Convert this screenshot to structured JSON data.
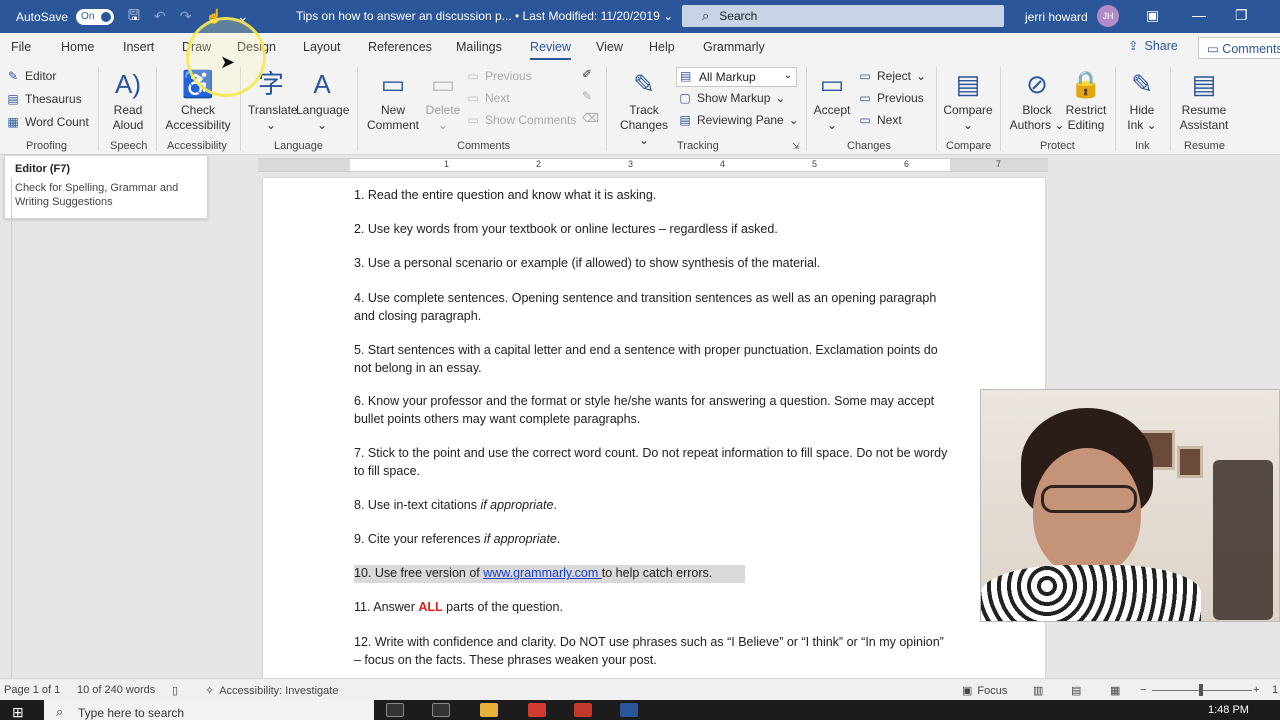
{
  "titlebar": {
    "autosave_label": "AutoSave",
    "autosave_state": "On",
    "doc_title": "Tips on how to answer an discussion p...  •  Last Modified: 11/20/2019  ⌄",
    "search_placeholder": "Search",
    "user_name": "jerri howard",
    "user_initials": "JH"
  },
  "tabs": [
    "File",
    "Home",
    "Insert",
    "Draw",
    "Design",
    "Layout",
    "References",
    "Mailings",
    "Review",
    "View",
    "Help",
    "Grammarly"
  ],
  "active_tab": "Review",
  "share_label": "Share",
  "comments_label": "Comments",
  "ribbon": {
    "proofing": {
      "editor": "Editor",
      "thesaurus": "Thesaurus",
      "word_count": "Word Count",
      "label": "Proofing"
    },
    "speech": {
      "read_aloud": "Read Aloud",
      "label": "Speech"
    },
    "accessibility": {
      "check": "Check Accessibility",
      "label": "Accessibility"
    },
    "language": {
      "translate": "Translate",
      "language": "Language",
      "label": "Language"
    },
    "comments": {
      "new_comment": "New Comment",
      "delete": "Delete",
      "previous": "Previous",
      "next": "Next",
      "show_comments": "Show Comments",
      "label": "Comments"
    },
    "tracking": {
      "track_changes": "Track Changes",
      "all_markup": "All Markup",
      "show_markup": "Show Markup",
      "reviewing_pane": "Reviewing Pane",
      "label": "Tracking"
    },
    "changes": {
      "accept": "Accept",
      "reject": "Reject",
      "previous": "Previous",
      "next": "Next",
      "label": "Changes"
    },
    "compare": {
      "compare": "Compare",
      "label": "Compare"
    },
    "protect": {
      "block_authors": "Block Authors",
      "restrict_editing": "Restrict Editing",
      "label": "Protect"
    },
    "ink": {
      "hide_ink": "Hide Ink",
      "label": "Ink"
    },
    "resume": {
      "resume_assistant": "Resume Assistant",
      "label": "Resume"
    }
  },
  "tooltip": {
    "title": "Editor (F7)",
    "body": "Check for Spelling, Grammar and Writing Suggestions"
  },
  "ruler": [
    "1",
    "2",
    "3",
    "4",
    "5",
    "6",
    "7"
  ],
  "document": {
    "p1": "1. Read the entire question and know what it is asking.",
    "p2": "2. Use key words from your textbook or online lectures – regardless if asked.",
    "p3": "3. Use a personal scenario or example (if allowed) to show synthesis of the material.",
    "p4": "4. Use complete sentences. Opening sentence and transition sentences as well as an opening paragraph and closing paragraph.",
    "p5": "5. Start sentences with a capital letter and end a sentence with proper punctuation. Exclamation points do not belong in an essay.",
    "p6": "6. Know your professor and the format or style he/she wants for answering a question. Some may accept bullet points others may want complete paragraphs.",
    "p7": "7. Stick to the point and use the correct word count. Do not repeat information to fill space. Do not be wordy to fill space.",
    "p8_pre": "8. Use in-text citations ",
    "p8_em": "if appropriate",
    "p8_post": ".",
    "p9_pre": "9. Cite your references ",
    "p9_em": "if appropriate",
    "p9_post": ".",
    "p10_pre": "10.  Use free version of ",
    "p10_link": "www.grammarly.com ",
    "p10_post": "to help catch errors.",
    "p11_pre": "11.  Answer ",
    "p11_bold": "ALL",
    "p11_post": " parts of the question.",
    "p12": "12. Write with confidence and clarity. Do NOT use phrases such as “I Believe” or “I think” or “In my opinion” – focus on the facts. These phrases weaken your post."
  },
  "status": {
    "page": "Page 1 of 1",
    "words": "10 of 240 words",
    "accessibility": "Accessibility: Investigate",
    "focus": "Focus",
    "zoom_minus": "−",
    "zoom_plus": "+",
    "zoom_value": "1"
  },
  "taskbar": {
    "search_placeholder": "Type here to search",
    "time": "1:48 PM"
  },
  "colors": {
    "brand": "#2b579a",
    "link": "#1a3ec9",
    "alert": "#e02020"
  }
}
